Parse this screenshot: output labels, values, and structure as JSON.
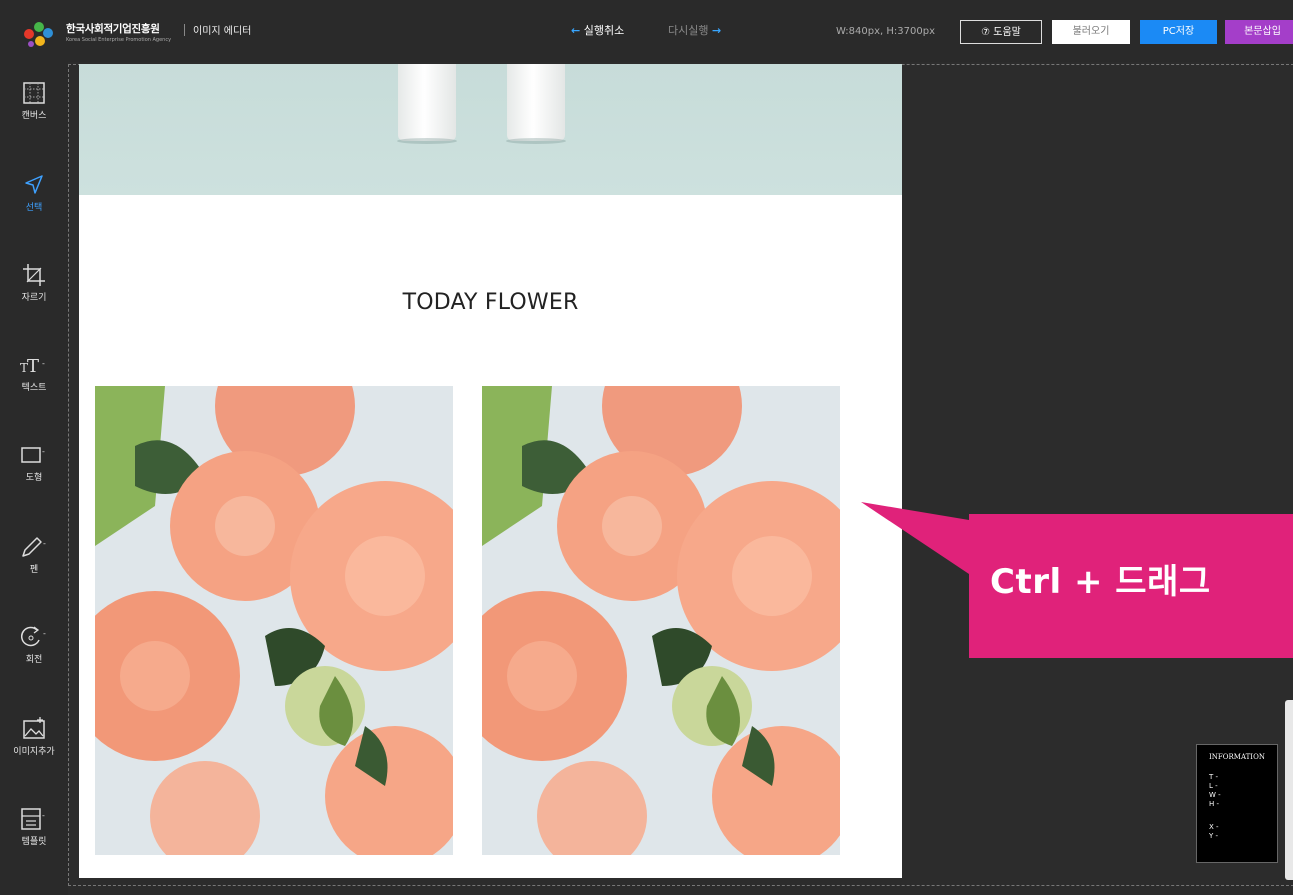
{
  "header": {
    "brand_name": "한국사회적기업진흥원",
    "brand_sub": "Korea Social Enterprise Promotion Agency",
    "app_title": "이미지 에디터",
    "undo_label": "실행취소",
    "redo_label": "다시실행",
    "canvas_size": "W:840px, H:3700px",
    "help_label": "도움말",
    "load_label": "불러오기",
    "save_label": "PC저장",
    "insert_label": "본문삽입"
  },
  "sidebar": {
    "items": [
      {
        "label": "캔버스",
        "icon": "canvas-grid-icon"
      },
      {
        "label": "선택",
        "icon": "cursor-select-icon"
      },
      {
        "label": "자르기",
        "icon": "crop-icon"
      },
      {
        "label": "텍스트",
        "icon": "text-tt-icon"
      },
      {
        "label": "도형",
        "icon": "shape-rectangle-icon"
      },
      {
        "label": "펜",
        "icon": "pen-icon"
      },
      {
        "label": "회전",
        "icon": "rotate-icon"
      },
      {
        "label": "이미지추가",
        "icon": "add-image-icon"
      },
      {
        "label": "템플릿",
        "icon": "template-icon"
      }
    ],
    "active": "선택"
  },
  "canvas": {
    "heading": "TODAY FLOWER"
  },
  "callout": {
    "text": "Ctrl + 드래그"
  },
  "info_panel": {
    "title": "INFORMATION",
    "rows": [
      "T -",
      "L -",
      "W -",
      "H -"
    ],
    "rows2": [
      "X -",
      "Y -"
    ]
  },
  "colors": {
    "accent_blue": "#1b8af5",
    "accent_purple": "#a43ec9",
    "callout_pink": "#e0227a",
    "active_tool": "#3ea1ff"
  }
}
